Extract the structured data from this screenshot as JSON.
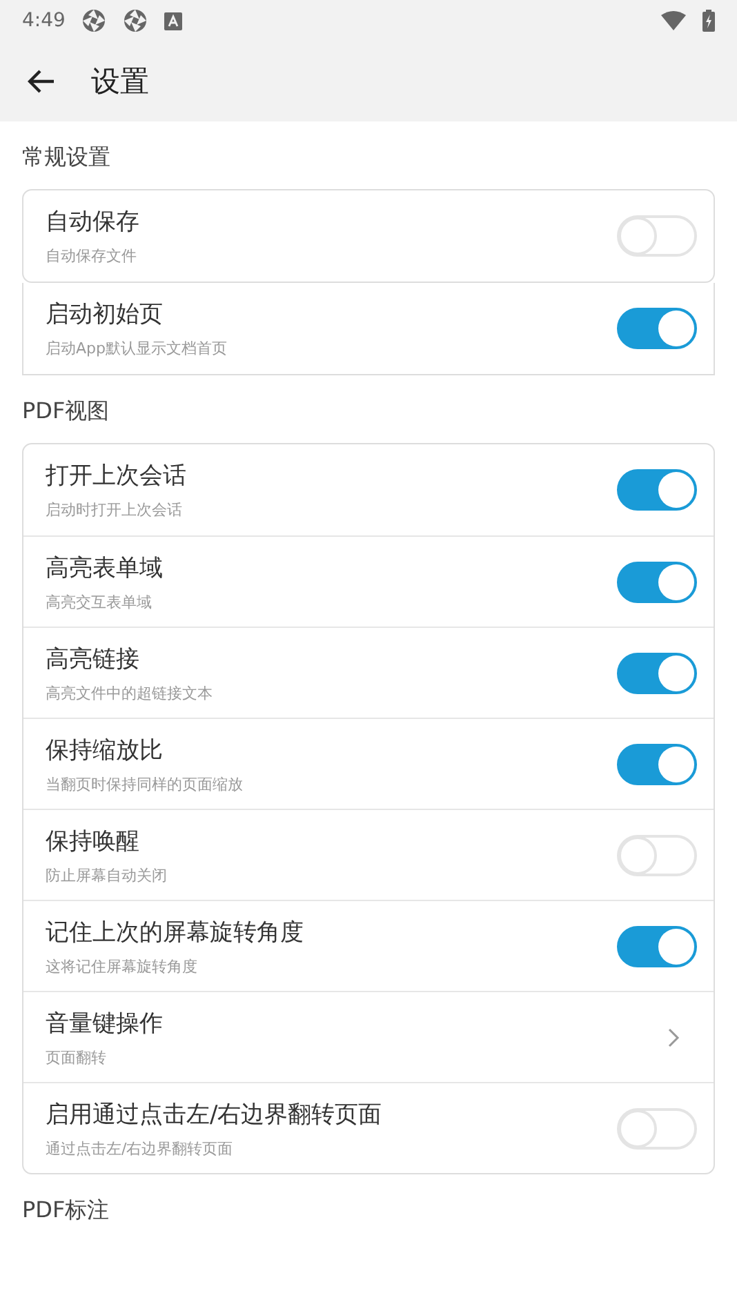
{
  "status_bar": {
    "time": "4:49"
  },
  "toolbar": {
    "title": "设置"
  },
  "sections": [
    {
      "title": "常规设置",
      "cards": [
        {
          "items": [
            {
              "kind": "switch",
              "title": "自动保存",
              "subtitle": "自动保存文件",
              "on": false
            }
          ]
        },
        {
          "items": [
            {
              "kind": "switch",
              "title": "启动初始页",
              "subtitle": "启动App默认显示文档首页",
              "on": true
            }
          ]
        }
      ]
    },
    {
      "title": "PDF视图",
      "cards": [
        {
          "items": [
            {
              "kind": "switch",
              "title": "打开上次会话",
              "subtitle": "启动时打开上次会话",
              "on": true
            },
            {
              "kind": "switch",
              "title": "高亮表单域",
              "subtitle": "高亮交互表单域",
              "on": true
            },
            {
              "kind": "switch",
              "title": "高亮链接",
              "subtitle": "高亮文件中的超链接文本",
              "on": true
            },
            {
              "kind": "switch",
              "title": "保持缩放比",
              "subtitle": "当翻页时保持同样的页面缩放",
              "on": true
            },
            {
              "kind": "switch",
              "title": "保持唤醒",
              "subtitle": "防止屏幕自动关闭",
              "on": false
            },
            {
              "kind": "switch",
              "title": "记住上次的屏幕旋转角度",
              "subtitle": "这将记住屏幕旋转角度",
              "on": true
            },
            {
              "kind": "link",
              "title": "音量键操作",
              "subtitle": "页面翻转"
            },
            {
              "kind": "switch",
              "title": "启用通过点击左/右边界翻转页面",
              "subtitle": "通过点击左/右边界翻转页面",
              "on": false
            }
          ]
        }
      ]
    },
    {
      "title": "PDF标注"
    }
  ]
}
